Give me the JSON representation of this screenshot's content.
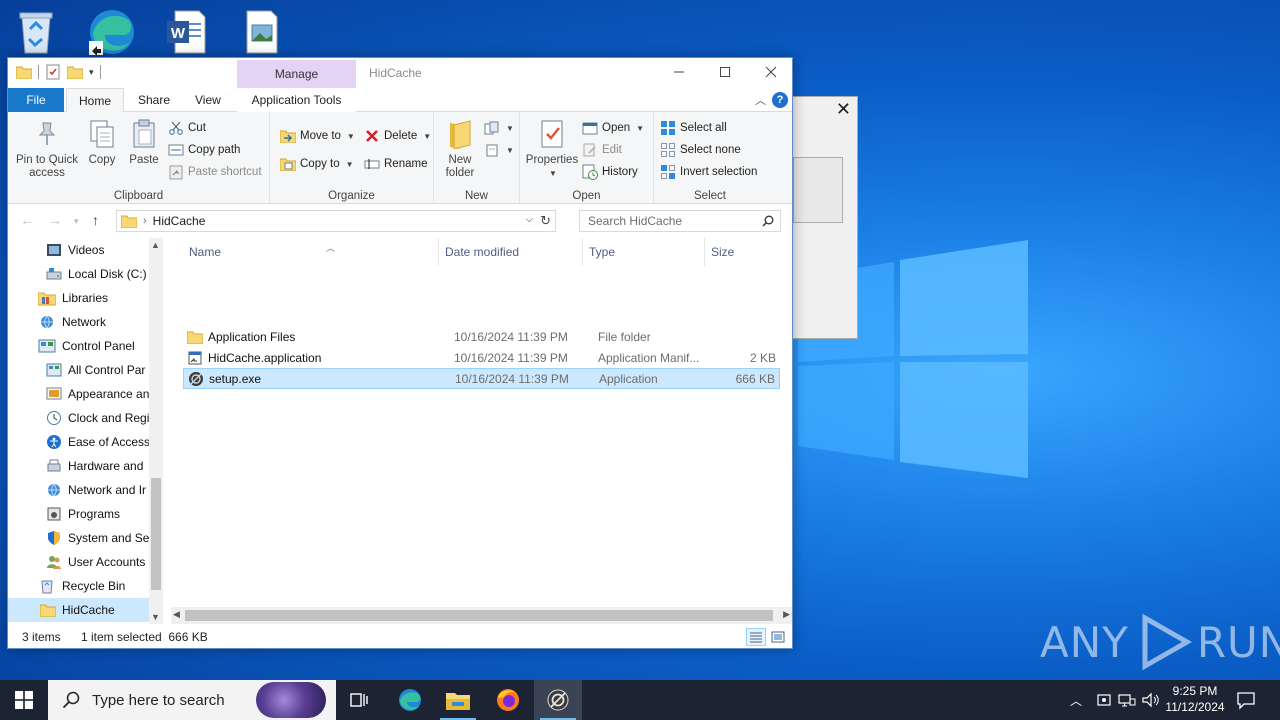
{
  "window": {
    "title": "HidCache",
    "manage_tab": "Manage",
    "app_tools_tab": "Application Tools"
  },
  "ribbon_tabs": [
    "File",
    "Home",
    "Share",
    "View"
  ],
  "ribbon": {
    "clipboard": {
      "label": "Clipboard",
      "pin": "Pin to Quick access",
      "pin_l1": "Pin to Quick",
      "pin_l2": "access",
      "copy": "Copy",
      "paste": "Paste",
      "cut": "Cut",
      "copy_path": "Copy path",
      "paste_shortcut": "Paste shortcut"
    },
    "organize": {
      "label": "Organize",
      "move_to": "Move to",
      "copy_to": "Copy to",
      "delete": "Delete",
      "rename": "Rename"
    },
    "new": {
      "label": "New",
      "new_folder_l1": "New",
      "new_folder_l2": "folder"
    },
    "open": {
      "label": "Open",
      "properties": "Properties",
      "open": "Open",
      "edit": "Edit",
      "history": "History"
    },
    "select": {
      "label": "Select",
      "select_all": "Select all",
      "select_none": "Select none",
      "invert": "Invert selection"
    }
  },
  "address": {
    "path": "HidCache",
    "search_placeholder": "Search HidCache"
  },
  "nav_pane": [
    {
      "label": "Videos",
      "icon": "videos-icon"
    },
    {
      "label": "Local Disk (C:)",
      "icon": "drive-icon"
    },
    {
      "label": "Libraries",
      "icon": "libraries-icon"
    },
    {
      "label": "Network",
      "icon": "network-icon"
    },
    {
      "label": "Control Panel",
      "icon": "control-panel-icon"
    },
    {
      "label": "All Control Par",
      "icon": "control-panel-icon"
    },
    {
      "label": "Appearance an",
      "icon": "appearance-icon"
    },
    {
      "label": "Clock and Regi",
      "icon": "clock-icon"
    },
    {
      "label": "Ease of Access",
      "icon": "ease-of-access-icon"
    },
    {
      "label": "Hardware and",
      "icon": "hardware-icon"
    },
    {
      "label": "Network and Ir",
      "icon": "network-internet-icon"
    },
    {
      "label": "Programs",
      "icon": "programs-icon"
    },
    {
      "label": "System and Sec",
      "icon": "system-security-icon"
    },
    {
      "label": "User Accounts",
      "icon": "user-accounts-icon"
    },
    {
      "label": "Recycle Bin",
      "icon": "recycle-bin-icon"
    },
    {
      "label": "HidCache",
      "icon": "folder-icon"
    }
  ],
  "columns": {
    "name": "Name",
    "date": "Date modified",
    "type": "Type",
    "size": "Size"
  },
  "files": [
    {
      "name": "Application Files",
      "date": "10/16/2024 11:39 PM",
      "type": "File folder",
      "size": ""
    },
    {
      "name": "HidCache.application",
      "date": "10/16/2024 11:39 PM",
      "type": "Application Manif...",
      "size": "2 KB"
    },
    {
      "name": "setup.exe",
      "date": "10/16/2024 11:39 PM",
      "type": "Application",
      "size": "666 KB"
    }
  ],
  "status": {
    "items": "3 items",
    "selected": "1 item selected  666 KB"
  },
  "taskbar": {
    "search_placeholder": "Type here to search",
    "time": "9:25 PM",
    "date": "11/12/2024"
  },
  "watermark": "ANY RUN",
  "watermark_left": "ANY",
  "watermark_right": "RUN",
  "colors": {
    "accent": "#1979ca",
    "selection": "#cce8ff",
    "manage_tab": "#e4d3f5",
    "taskbar": "#1c2433"
  }
}
